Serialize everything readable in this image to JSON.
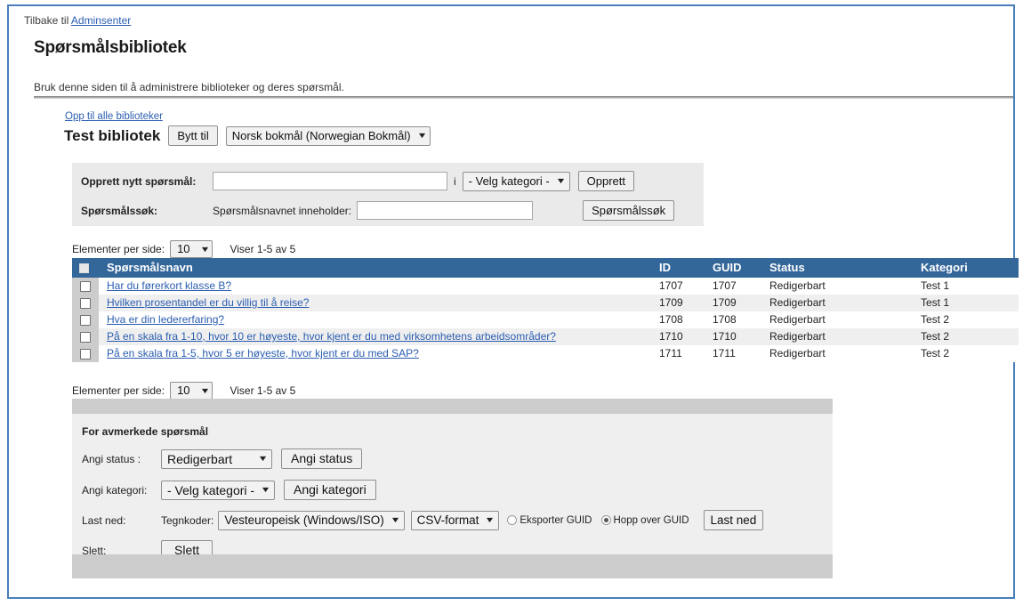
{
  "header": {
    "back_prefix": "Tilbake til ",
    "back_link": "Adminsenter",
    "title": "Spørsmålsbibliotek",
    "description": "Bruk denne siden til å administrere biblioteker og deres spørsmål."
  },
  "library": {
    "up_link": "Opp til alle biblioteker",
    "name": "Test bibliotek",
    "switch_button": "Bytt til",
    "language_select": "Norsk bokmål (Norwegian Bokmål)"
  },
  "create_form": {
    "create_label": "Opprett nytt spørsmål:",
    "name_value": "",
    "name_placeholder": "",
    "in_word": "i",
    "category_select": "- Velg kategori -",
    "create_button": "Opprett",
    "search_label": "Spørsmålssøk:",
    "search_sub_label": "Spørsmålsnavnet inneholder:",
    "search_value": "",
    "search_placeholder": "",
    "search_button": "Spørsmålssøk"
  },
  "pager": {
    "per_page_label": "Elementer per side:",
    "per_page_value": "10",
    "showing": "Viser 1-5 av 5"
  },
  "table": {
    "columns": {
      "name": "Spørsmålsnavn",
      "id": "ID",
      "guid": "GUID",
      "status": "Status",
      "kategori": "Kategori"
    },
    "rows": [
      {
        "name": "Har du førerkort klasse B?",
        "id": "1707",
        "guid": "1707",
        "status": "Redigerbart",
        "kategori": "Test 1"
      },
      {
        "name": "Hvilken prosentandel er du villig til å reise?",
        "id": "1709",
        "guid": "1709",
        "status": "Redigerbart",
        "kategori": "Test 1"
      },
      {
        "name": "Hva er din ledererfaring?",
        "id": "1708",
        "guid": "1708",
        "status": "Redigerbart",
        "kategori": "Test 2"
      },
      {
        "name": "På en skala fra 1-10, hvor 10 er høyeste, hvor kjent er du med virksomhetens arbeidsområder?",
        "id": "1710",
        "guid": "1710",
        "status": "Redigerbart",
        "kategori": "Test 2"
      },
      {
        "name": "På en skala fra 1-5, hvor 5 er høyeste, hvor kjent er du med SAP?",
        "id": "1711",
        "guid": "1711",
        "status": "Redigerbart",
        "kategori": "Test 2"
      }
    ]
  },
  "bulk": {
    "title": "For avmerkede spørsmål",
    "status_label": "Angi status :",
    "status_value": "Redigerbart",
    "status_button": "Angi status",
    "kategori_label": "Angi kategori:",
    "kategori_value": "- Velg kategori -",
    "kategori_button": "Angi kategori",
    "download_label": "Last ned:",
    "encoding_label": "Tegnkoder:",
    "encoding_value": "Vesteuropeisk (Windows/ISO)",
    "format_value": "CSV-format",
    "radio_export_guid": "Eksporter GUID",
    "radio_skip_guid": "Hopp over GUID",
    "radio_selected": "Hopp over GUID",
    "download_button": "Last ned",
    "delete_label": "Slett:",
    "delete_button": "Slett"
  },
  "colors": {
    "table_header_bg": "#336699",
    "link": "#2a5db0",
    "frame_border": "#4a7ebb",
    "panel_bg": "#efefef",
    "bar_bg": "#cccccc"
  }
}
